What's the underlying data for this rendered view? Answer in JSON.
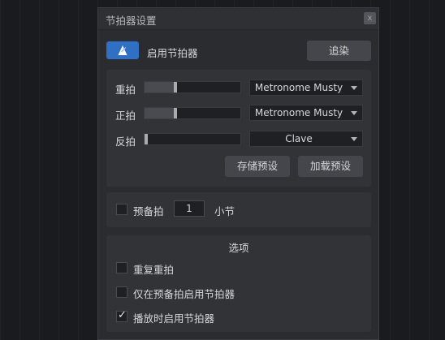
{
  "window": {
    "title": "节拍器设置",
    "close_label": "x"
  },
  "toolbar": {
    "enable_label": "启用节拍器",
    "render_label": "追染",
    "icon": "metronome-icon"
  },
  "sounds": {
    "rows": [
      {
        "label": "重拍",
        "level": 0.32,
        "sound": "Metronome Musty"
      },
      {
        "label": "正拍",
        "level": 0.32,
        "sound": "Metronome Musty"
      },
      {
        "label": "反拍",
        "level": 0.02,
        "sound": "Clave"
      }
    ],
    "save_preset_label": "存储预设",
    "load_preset_label": "加载预设"
  },
  "precount": {
    "label": "预备拍",
    "value": "1",
    "unit_label": "小节",
    "checked": false
  },
  "options": {
    "title": "选项",
    "items": [
      {
        "label": "重复重拍",
        "checked": false
      },
      {
        "label": "仅在预备拍启用节拍器",
        "checked": false
      },
      {
        "label": "播放时启用节拍器",
        "checked": true
      }
    ]
  },
  "colors": {
    "accent": "#2f6fc4",
    "panel": "#323337",
    "dialog": "#2b2c30"
  }
}
